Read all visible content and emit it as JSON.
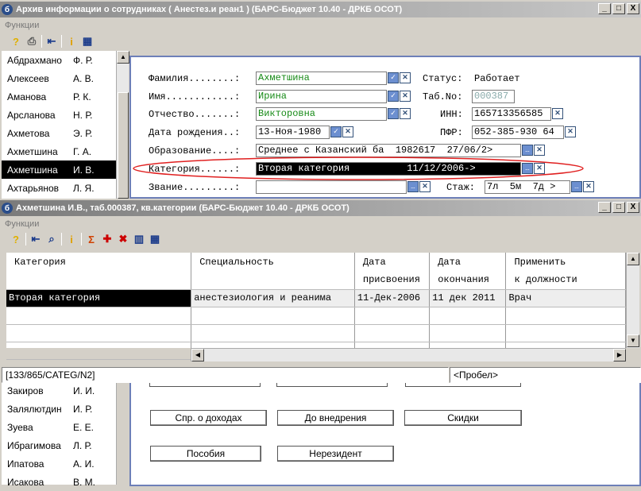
{
  "window1": {
    "title": "Архив информации о сотрудниках ( Анестез.и реан1 ) (БАРС-Бюджет 10.40 - ДРКБ ОСОТ)",
    "menu": "Функции",
    "min": "_",
    "max": "□",
    "close": "X"
  },
  "employees": [
    {
      "name": "Абдрахмано",
      "init": "Ф. Р."
    },
    {
      "name": "Алексеев",
      "init": "А. В."
    },
    {
      "name": "Аманова",
      "init": "Р. К."
    },
    {
      "name": "Арсланова",
      "init": "Н. Р."
    },
    {
      "name": "Ахметова",
      "init": "Э. Р."
    },
    {
      "name": "Ахметшина",
      "init": "Г. А."
    },
    {
      "name": "Ахметшина",
      "init": "И. В."
    },
    {
      "name": "Ахтарьянов",
      "init": "Л. Я."
    }
  ],
  "employees_bottom": [
    {
      "name": "Закиров",
      "init": "И. И."
    },
    {
      "name": "Залялютдин",
      "init": "И. Р."
    },
    {
      "name": "Зуева",
      "init": "Е. Е."
    },
    {
      "name": "Ибрагимова",
      "init": "Л. Р."
    },
    {
      "name": "Ипатова",
      "init": "А. И."
    },
    {
      "name": "Исакова",
      "init": "В. М."
    }
  ],
  "form": {
    "surname_label": "Фамилия........:",
    "surname": "Ахметшина",
    "name_label": "Имя............:",
    "name": "Ирина",
    "patronymic_label": "Отчество.......:",
    "patronymic": "Викторовна",
    "birth_label": "Дата рождения..:",
    "birth": "13-Ноя-1980",
    "education_label": "Образование....:",
    "education": "Среднее с Казанский ба  1982617  27/06/2>",
    "category_label": "Категория......:",
    "category": "Вторая категория          11/12/2006->",
    "rank_label": "Звание.........:",
    "rank": "                             >",
    "status_label": "Статус:",
    "status": "Работает",
    "tabno_label": "Таб.No:",
    "tabno": "000387",
    "inn_label": "ИНН:",
    "inn": "165713356585",
    "pfr_label": "ПФР:",
    "pfr": "052-385-930 64",
    "stazh_label": "Стаж:",
    "stazh": "7л  5м  7д >"
  },
  "window2": {
    "title": "Ахметшина И.В., таб.000387, кв.категории (БАРС-Бюджет 10.40 - ДРКБ ОСОТ)",
    "menu": "Функции",
    "min": "_",
    "max": "□",
    "close": "X"
  },
  "table": {
    "headers": [
      [
        "Категория",
        ""
      ],
      [
        "Специальность",
        ""
      ],
      [
        "Дата",
        "присвоения"
      ],
      [
        "Дата",
        "окончания"
      ],
      [
        "Применить",
        "к должности"
      ]
    ],
    "rows": [
      [
        "Вторая категория",
        "анестезиология и реанима",
        "11-Дек-2006",
        "11 дек 2011",
        "Врач"
      ]
    ]
  },
  "statusbar": {
    "code": "[133/865/CATEG/N2]",
    "hint": "<Пробел>"
  },
  "buttons": {
    "income": "Спр. о доходах",
    "before": "До внедрения",
    "discounts": "Скидки",
    "benefits": "Пособия",
    "nonresident": "Нерезидент"
  },
  "colors": {
    "accent": "#168a16",
    "highlight": "#000000",
    "circle": "#e02020"
  }
}
